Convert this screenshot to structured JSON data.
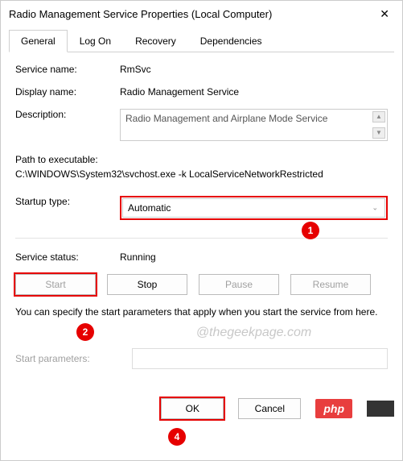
{
  "window": {
    "title": "Radio Management Service Properties (Local Computer)",
    "close": "✕"
  },
  "tabs": [
    "General",
    "Log On",
    "Recovery",
    "Dependencies"
  ],
  "fields": {
    "service_name_label": "Service name:",
    "service_name_value": "RmSvc",
    "display_name_label": "Display name:",
    "display_name_value": "Radio Management Service",
    "description_label": "Description:",
    "description_value": "Radio Management and Airplane Mode Service",
    "path_label": "Path to executable:",
    "path_value": "C:\\WINDOWS\\System32\\svchost.exe -k LocalServiceNetworkRestricted",
    "startup_label": "Startup type:",
    "startup_value": "Automatic",
    "status_label": "Service status:",
    "status_value": "Running",
    "hint": "You can specify the start parameters that apply when you start the service from here.",
    "param_label": "Start parameters:",
    "param_value": ""
  },
  "buttons": {
    "start": "Start",
    "stop": "Stop",
    "pause": "Pause",
    "resume": "Resume",
    "ok": "OK",
    "cancel": "Cancel"
  },
  "badges": {
    "b1": "1",
    "b2": "2",
    "b4": "4"
  },
  "watermark": "@thegeekpage.com",
  "php": "php"
}
